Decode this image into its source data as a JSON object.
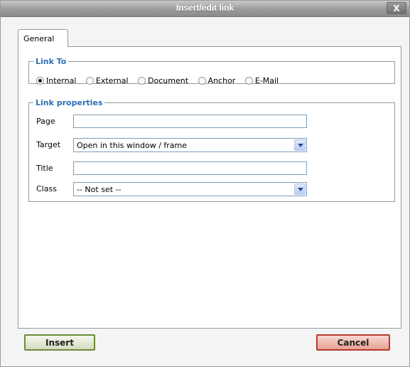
{
  "window": {
    "title": "Insert/edit link",
    "close_label": "X"
  },
  "tabs": [
    {
      "label": "General",
      "active": true
    }
  ],
  "link_to": {
    "legend": "Link To",
    "options": [
      {
        "label": "Internal",
        "selected": true
      },
      {
        "label": "External",
        "selected": false
      },
      {
        "label": "Document",
        "selected": false
      },
      {
        "label": "Anchor",
        "selected": false
      },
      {
        "label": "E-Mail",
        "selected": false
      }
    ]
  },
  "link_properties": {
    "legend": "Link properties",
    "page": {
      "label": "Page",
      "value": ""
    },
    "target": {
      "label": "Target",
      "value": "Open in this window / frame"
    },
    "title": {
      "label": "Title",
      "value": ""
    },
    "class": {
      "label": "Class",
      "value": "-- Not set --"
    }
  },
  "buttons": {
    "insert": "Insert",
    "cancel": "Cancel"
  }
}
